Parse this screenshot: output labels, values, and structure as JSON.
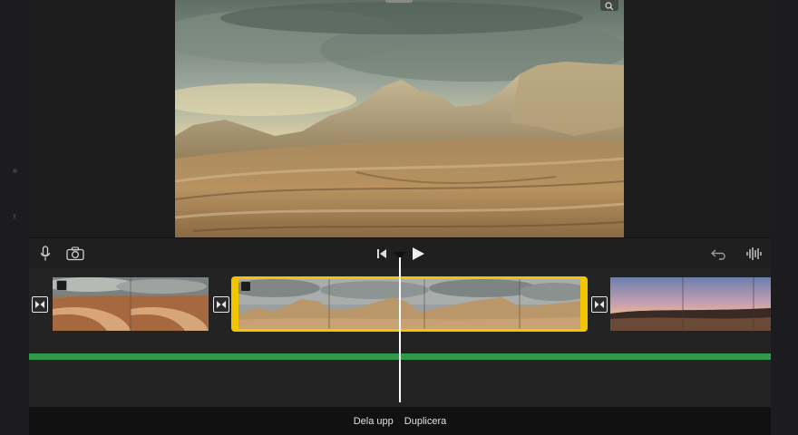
{
  "toolbar": {
    "mic_icon": "microphone-icon",
    "camera_icon": "camera-icon",
    "skip_icon": "skip-to-start-icon",
    "play_icon": "play-icon",
    "undo_icon": "undo-icon",
    "audio_icon": "audio-waveform-icon"
  },
  "timeline": {
    "accent_color": "#f2c500",
    "audio_color": "#2f9a4a"
  },
  "actions": {
    "split_label": "Dela upp",
    "duplicate_label": "Duplicera"
  }
}
